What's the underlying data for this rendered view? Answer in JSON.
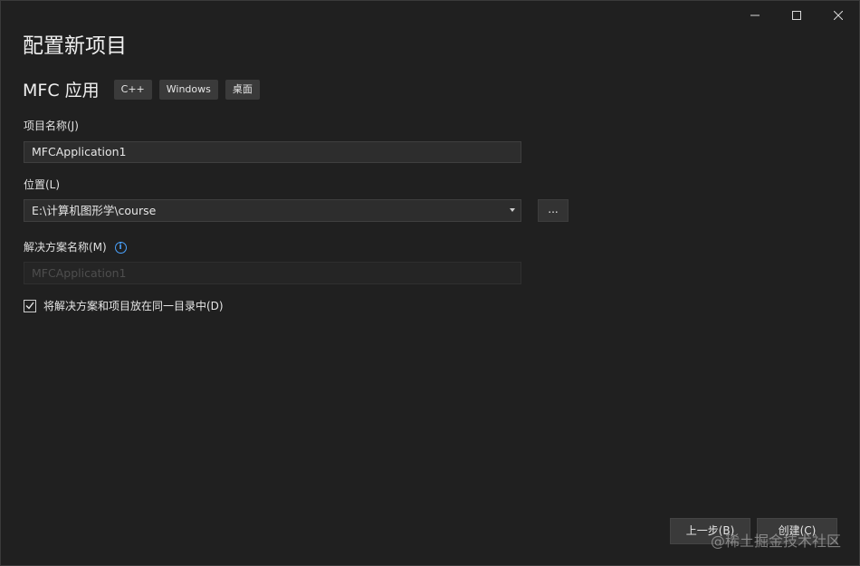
{
  "window": {
    "controls": [
      "minimize",
      "maximize",
      "close"
    ]
  },
  "page": {
    "title": "配置新项目",
    "subtitle": "MFC 应用",
    "tags": [
      "C++",
      "Windows",
      "桌面"
    ]
  },
  "form": {
    "project_name_label": "项目名称(J)",
    "project_name_value": "MFCApplication1",
    "location_label": "位置(L)",
    "location_value": "E:\\计算机图形学\\course",
    "browse_label": "...",
    "solution_name_label": "解决方案名称(M)",
    "solution_name_value": "MFCApplication1",
    "same_dir_checkbox_label": "将解决方案和项目放在同一目录中(D)",
    "same_dir_checked": true
  },
  "footer": {
    "back_label": "上一步(B)",
    "create_label": "创建(C)"
  },
  "watermark": "@稀土掘金技术社区",
  "colors": {
    "background": "#202020",
    "field": "#2d2d2d",
    "button": "#3a3a3a",
    "info_accent": "#4aa3ff"
  }
}
